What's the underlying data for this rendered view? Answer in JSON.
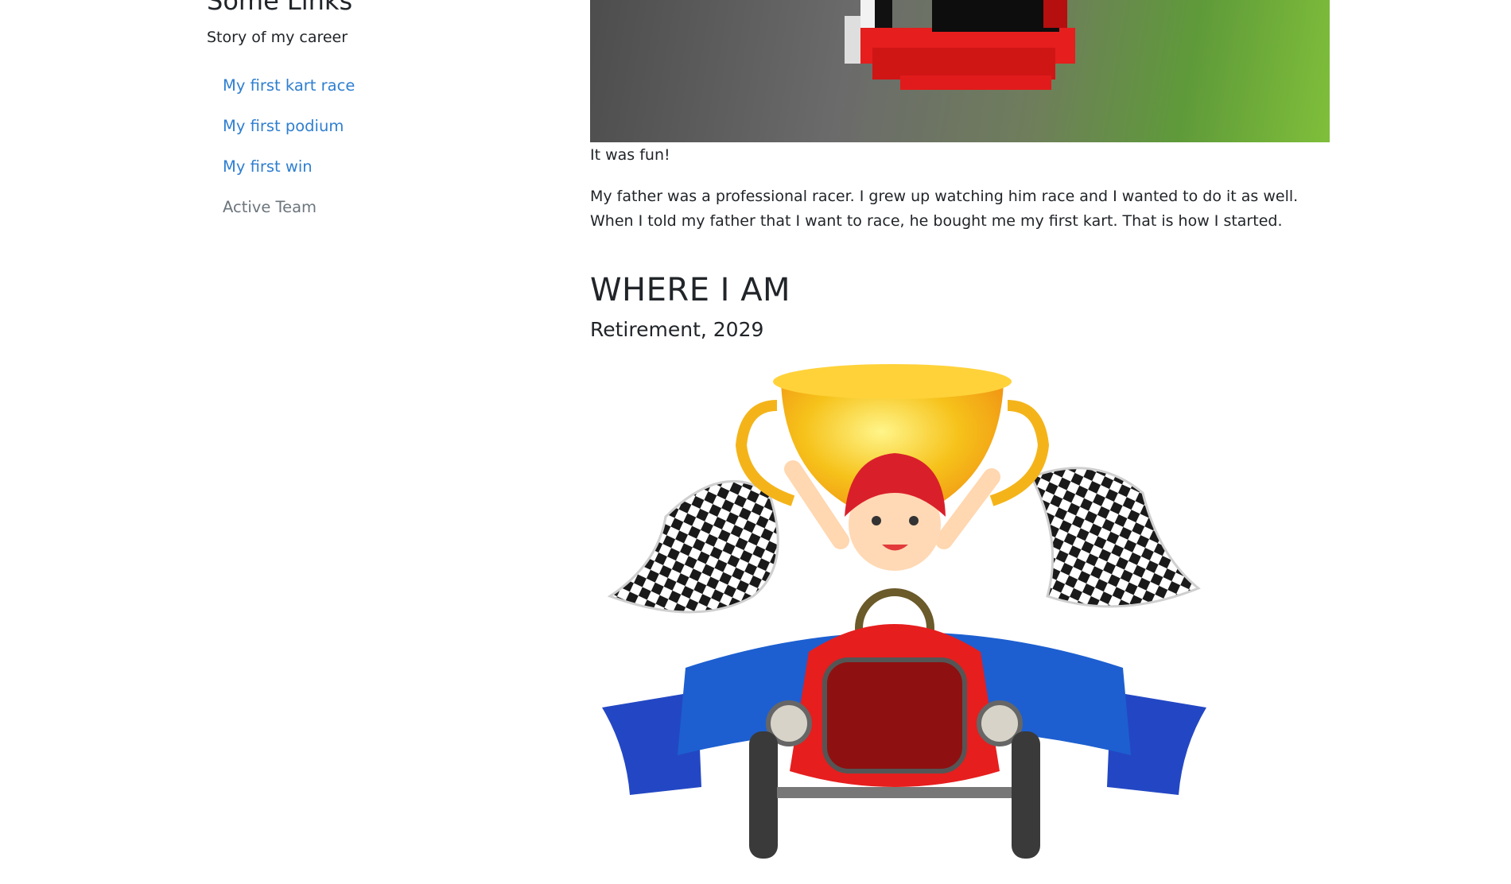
{
  "sidebar": {
    "title": "Some Links",
    "subtitle": "Story of my career",
    "links": [
      {
        "label": "My first kart race"
      },
      {
        "label": "My first podium"
      },
      {
        "label": "My first win"
      },
      {
        "label": "Active Team"
      }
    ]
  },
  "main": {
    "image_caption": "It was fun!",
    "paragraph": "My father was a professional racer. I grew up watching him race and I wanted to do it as well. When I told my father that I want to race, he bought me my first kart. That is how I started.",
    "section_title": "WHERE I AM",
    "section_subtitle": "Retirement, 2029"
  },
  "colors": {
    "link": "#2f7fd0",
    "muted": "#6c757d",
    "text": "#212529",
    "kart_red": "#e61e1e",
    "ribbon_blue": "#1d5fd0",
    "trophy_gold": "#f6c21a"
  }
}
